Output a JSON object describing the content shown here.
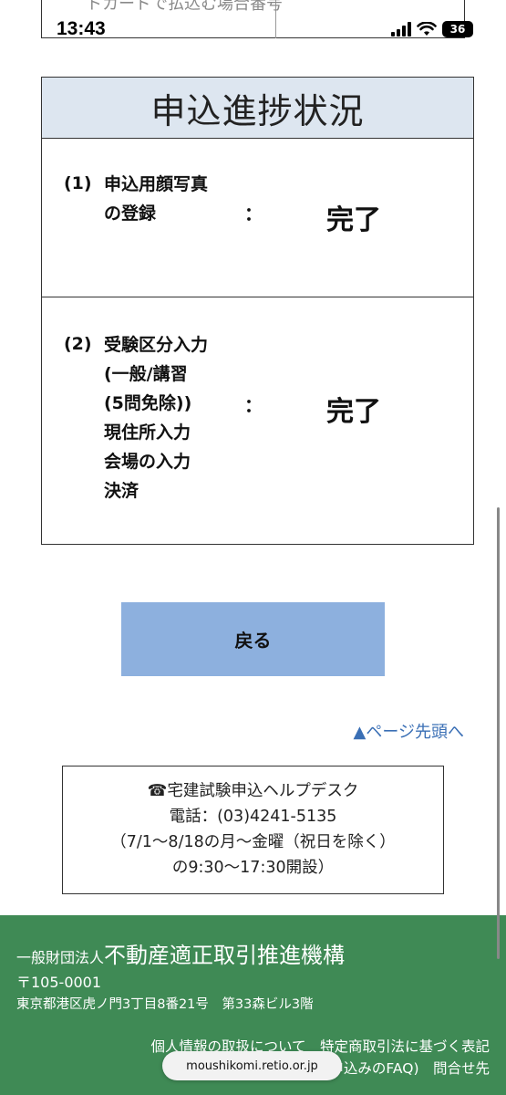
{
  "status_bar": {
    "time": "13:43",
    "battery": "36"
  },
  "top_partial": {
    "text": "トカードで払込む場合番号"
  },
  "progress": {
    "title": "申込進捗状況",
    "rows": [
      {
        "num": "(1)",
        "lines": [
          "申込用顔写真",
          "の登録"
        ],
        "colon": "：",
        "status": "完了"
      },
      {
        "num": "(2)",
        "lines": [
          "受験区分入力",
          "(一般/講習",
          "(5問免除))",
          "現住所入力",
          "会場の入力",
          "決済"
        ],
        "colon": "：",
        "status": "完了"
      }
    ]
  },
  "back_button": {
    "label": "戻る"
  },
  "page_top_link": {
    "label": "▲ページ先頭へ"
  },
  "helpdesk": {
    "title": "☎宅建試験申込ヘルプデスク",
    "phone": "電話：(03)4241-5135",
    "hours1": "（7/1〜8/18の月〜金曜（祝日を除く）",
    "hours2": "の9:30〜17:30開設）"
  },
  "footer": {
    "org_prefix": "一般財団法人",
    "org_name": "不動産適正取引推進機構",
    "zip": "〒105-0001",
    "address": "東京都港区虎ノ門3丁目8番21号　第33森ビル3階",
    "links_line1": "個人情報の取扱について　特定商取引法に基づく表記",
    "links_line2": "よくある質問(各種申込みのFAQ)　問合せ先",
    "url": "moushikomi.retio.or.jp"
  },
  "colors": {
    "header_bg": "#dde6f0",
    "button_bg": "#8db0de",
    "footer_bg": "#3f8a55",
    "link": "#3a6fb5"
  }
}
